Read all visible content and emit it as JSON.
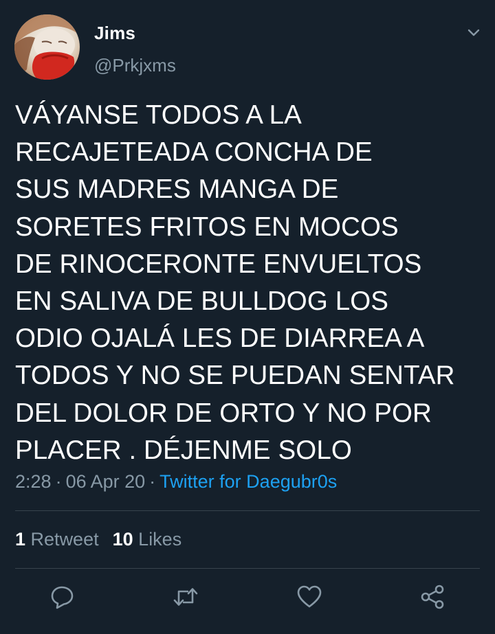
{
  "tweet": {
    "author": {
      "name": "Jims",
      "handle": "@Prkjxms"
    },
    "text": "VÁYANSE TODOS A LA\nRECAJETEADA CONCHA DE\nSUS MADRES MANGA DE\nSORETES FRITOS EN MOCOS\nDE RINOCERONTE ENVUELTOS\nEN SALIVA DE BULLDOG LOS\nODIO OJALÁ LES DE DIARREA A\nTODOS Y NO SE PUEDAN SENTAR\nDEL DOLOR DE ORTO Y NO POR\nPLACER . DÉJENME SOLO",
    "time": "2:28",
    "separator": "·",
    "date": "06 Apr 20",
    "source": "Twitter for Daegubr0s"
  },
  "stats": {
    "retweets_count": "1",
    "retweets_label": "Retweet",
    "likes_count": "10",
    "likes_label": "Likes"
  },
  "actions": {
    "reply": "reply-icon",
    "retweet": "retweet-icon",
    "like": "heart-icon",
    "share": "share-icon"
  },
  "colors": {
    "background": "#15202b",
    "text": "#ffffff",
    "secondary_text": "#8899a6",
    "link": "#1da1f2",
    "divider": "#38444d"
  }
}
